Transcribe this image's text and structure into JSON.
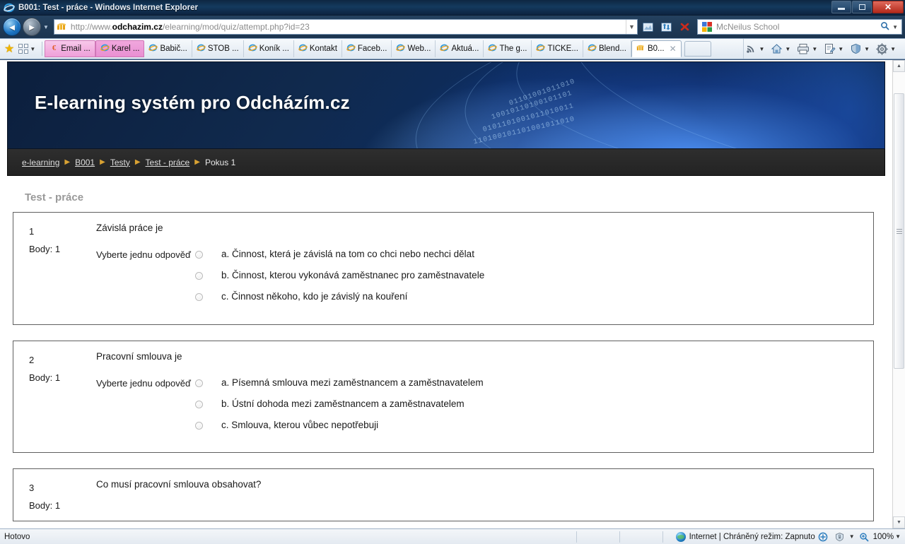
{
  "window": {
    "title": "B001: Test - práce - Windows Internet Explorer",
    "ie_logo_icon": "internet-explorer-logo-icon",
    "minimize_icon": "minimize-icon",
    "maximize_icon": "maximize-icon",
    "close_icon": "close-icon"
  },
  "navbar": {
    "back_icon": "back-arrow-icon",
    "forward_icon": "forward-arrow-icon",
    "recent_pages_caret": "chevron-down-icon",
    "url_prefix": "http://www.",
    "url_domain": "odchazim.cz",
    "url_path": "/elearning/mod/quiz/attempt.php?id=23",
    "site_icon": "moodle-favicon-icon",
    "address_dropdown_icon": "chevron-down-icon",
    "compat_view_icon": "compatibility-view-icon",
    "refresh_icon": "refresh-icon",
    "stop_icon": "stop-icon",
    "search": {
      "placeholder": "McNeilus School",
      "provider_icon": "google-icon",
      "magnifier_icon": "search-icon",
      "dropdown_icon": "chevron-down-icon"
    }
  },
  "favbar": {
    "favorites_star_icon": "favorites-star-icon",
    "favorites_bar_icon": "favorites-bar-icon",
    "overflow_caret_icon": "chevron-down-icon",
    "items": [
      {
        "label": "Email ...",
        "icon": "euro-favicon-icon",
        "style": "pink"
      },
      {
        "label": "Karel ...",
        "icon": "ie-favicon-icon",
        "style": "pink2"
      },
      {
        "label": "Babič...",
        "icon": "ie-favicon-icon",
        "style": "plain"
      },
      {
        "label": "STOB ...",
        "icon": "ie-favicon-icon",
        "style": "plain"
      },
      {
        "label": "Koník ...",
        "icon": "ie-favicon-icon",
        "style": "plain"
      },
      {
        "label": "Kontakt",
        "icon": "ie-favicon-icon",
        "style": "plain"
      },
      {
        "label": "Faceb...",
        "icon": "ie-favicon-icon",
        "style": "plain"
      },
      {
        "label": "Web...",
        "icon": "ie-favicon-icon",
        "style": "plain"
      },
      {
        "label": "Aktuá...",
        "icon": "ie-favicon-icon",
        "style": "plain"
      },
      {
        "label": "The g...",
        "icon": "ie-favicon-icon",
        "style": "plain"
      },
      {
        "label": "TICKE...",
        "icon": "ie-favicon-icon",
        "style": "plain"
      },
      {
        "label": "Blend...",
        "icon": "ie-favicon-icon",
        "style": "plain"
      },
      {
        "label": "B0...",
        "icon": "moodle-favicon-icon",
        "style": "active",
        "close_icon": "close-tab-icon"
      }
    ],
    "new_tab_label": "",
    "tools": [
      {
        "name": "feeds-icon",
        "label": ""
      },
      {
        "name": "home-icon",
        "label": ""
      },
      {
        "name": "print-icon",
        "label": ""
      },
      {
        "name": "page-icon",
        "label": ""
      },
      {
        "name": "safety-shield-icon",
        "label": ""
      },
      {
        "name": "tools-gear-icon",
        "label": ""
      }
    ]
  },
  "page": {
    "banner_title": "E-learning systém pro Odcházím.cz",
    "breadcrumb": {
      "separator_icon": "triangle-right-icon",
      "items": [
        {
          "label": "e-learning",
          "link": true
        },
        {
          "label": "B001",
          "link": true
        },
        {
          "label": "Testy",
          "link": true
        },
        {
          "label": "Test - práce",
          "link": true
        },
        {
          "label": "Pokus 1",
          "link": false
        }
      ]
    },
    "quiz_title": "Test - práce",
    "answer_instruction": "Vyberte jednu odpověď",
    "points_prefix": "Body:",
    "questions": [
      {
        "number": "1",
        "points": "Body: 1",
        "text": "Závislá práce je",
        "instruction": "Vyberte jednu odpověď",
        "answers": [
          "a. Činnost, která je závislá na tom co chci nebo nechci dělat",
          "b. Činnost, kterou vykonává zaměstnanec pro zaměstnavatele",
          "c. Činnost někoho, kdo je závislý na kouření"
        ]
      },
      {
        "number": "2",
        "points": "Body: 1",
        "text": "Pracovní smlouva je",
        "instruction": "Vyberte jednu odpověď",
        "answers": [
          "a. Písemná smlouva mezi zaměstnancem a zaměstnavatelem",
          "b. Ústní dohoda mezi zaměstnancem a zaměstnavatelem",
          "c. Smlouva, kterou vůbec nepotřebuji"
        ]
      },
      {
        "number": "3",
        "points": "Body: 1",
        "text": "Co musí pracovní smlouva obsahovat?",
        "instruction": "",
        "answers": []
      }
    ],
    "scrollbar": {
      "up_icon": "scroll-up-icon",
      "down_icon": "scroll-down-icon"
    }
  },
  "statusbar": {
    "status_text": "Hotovo",
    "zone_text": "Internet | Chráněný režim: Zapnuto",
    "zone_icon": "internet-zone-globe-icon",
    "enlarge_icon": "enlarge-icon",
    "privacy_icon": "privacy-report-icon",
    "privacy_dropdown_icon": "chevron-down-icon",
    "zoom_icon": "zoom-icon",
    "zoom_level": "100%",
    "zoom_dropdown_icon": "chevron-down-icon"
  },
  "colors": {
    "accent_blue": "#1d76c4",
    "breadcrumb_arrow": "#d9a233",
    "banner_dark": "#0c1f3d"
  }
}
